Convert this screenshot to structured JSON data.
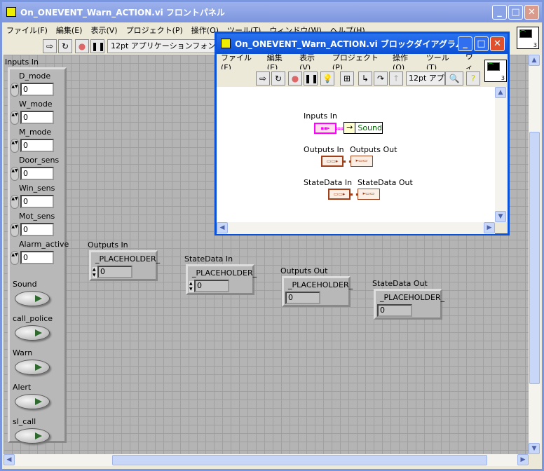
{
  "front_panel": {
    "title": "On_ONEVENT_Warn_ACTION.vi フロントパネル",
    "menu": [
      "ファイル(F)",
      "編集(E)",
      "表示(V)",
      "プロジェクト(P)",
      "操作(O)",
      "ツール(T)",
      "ウィンドウ(W)",
      "ヘルプ(H)"
    ],
    "font_select": "12pt アプリケーションフォント",
    "connector_number": "3",
    "inputs_cluster": {
      "label": "Inputs In",
      "numerics": [
        {
          "label": "D_mode",
          "value": "0"
        },
        {
          "label": "W_mode",
          "value": "0"
        },
        {
          "label": "M_mode",
          "value": "0"
        },
        {
          "label": "Door_sens",
          "value": "0"
        },
        {
          "label": "Win_sens",
          "value": "0"
        },
        {
          "label": "Mot_sens",
          "value": "0"
        },
        {
          "label": "Alarm_active",
          "value": "0"
        }
      ],
      "booleans": [
        {
          "label": "Sound"
        },
        {
          "label": "call_police"
        },
        {
          "label": "Warn"
        },
        {
          "label": "Alert"
        },
        {
          "label": "sl_call"
        }
      ]
    },
    "clusters": [
      {
        "label": "Outputs In",
        "item": "_PLACEHOLDER_",
        "value": "0",
        "control": true
      },
      {
        "label": "StateData In",
        "item": "_PLACEHOLDER_",
        "value": "0",
        "control": true
      },
      {
        "label": "Outputs Out",
        "item": "_PLACEHOLDER_",
        "value": "0",
        "control": false
      },
      {
        "label": "StateData Out",
        "item": "_PLACEHOLDER_",
        "value": "0",
        "control": false
      }
    ]
  },
  "block_diagram": {
    "title": "On_ONEVENT_Warn_ACTION.vi ブロックダイアグラム",
    "menu": [
      "ファイル(F)",
      "編集(E)",
      "表示(V)",
      "プロジェクト(P)",
      "操作(O)",
      "ツール(T)",
      "ウィ"
    ],
    "font_select": "12pt アプリ",
    "connector_number": "3",
    "nodes": {
      "inputs_in": "Inputs In",
      "unbundle_item": "Sound",
      "outputs_in": "Outputs In",
      "outputs_out": "Outputs Out",
      "statedata_in": "StateData In",
      "statedata_out": "StateData Out"
    }
  },
  "colors": {
    "active_title": "#0a53d8",
    "inactive_title": "#7a96df",
    "cluster_wire": "#ff00ff",
    "typedef_wire": "#a0401a"
  }
}
